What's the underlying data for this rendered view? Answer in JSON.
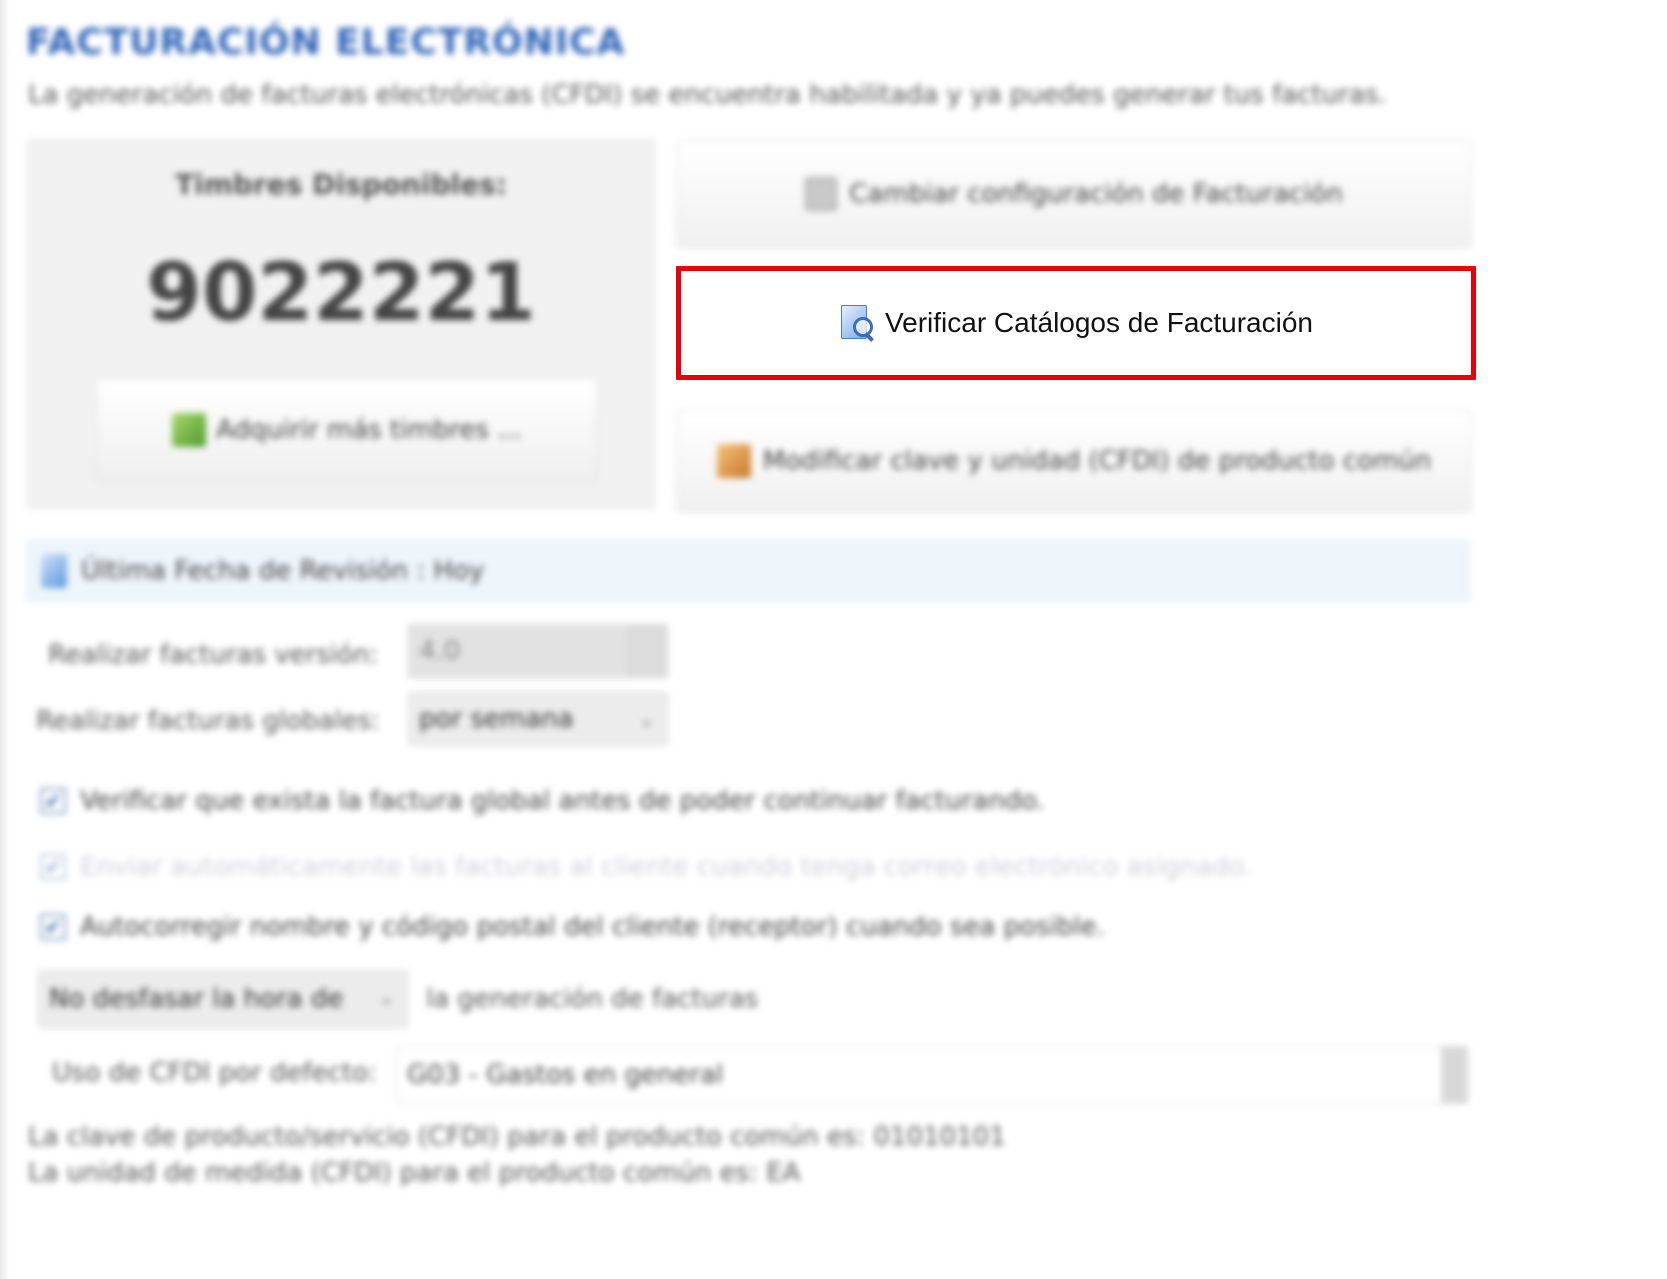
{
  "header": {
    "title": "FACTURACIÓN ELECTRÓNICA",
    "subtitle": "La generación de facturas electrónicas (CFDI) se encuentra habilitada y ya puedes generar tus facturas."
  },
  "stamps": {
    "label": "Timbres Disponibles:",
    "count": "9022221",
    "buy_label": "Adquirir más timbres ..."
  },
  "actions": {
    "change_config_label": "Cambiar configuración de Facturación",
    "verify_catalogs_label": "Verificar Catálogos de Facturación",
    "modify_key_label": "Modificar clave y unidad (CFDI) de producto común"
  },
  "review": {
    "text": "Última Fecha de Revisión : Hoy"
  },
  "settings": {
    "version_label": "Realizar facturas versión:",
    "version_value": "4.0",
    "global_label": "Realizar facturas globales:",
    "global_value": "por semana",
    "check_global_label": "Verificar que exista la factura global antes de poder continuar facturando.",
    "check_global_checked": true,
    "send_email_label": "Enviar automáticamente las facturas al cliente cuando tenga correo electrónico asignado.",
    "send_email_checked": true,
    "autocorrect_label": "Autocorregir nombre y código postal del cliente (receptor) cuando sea posible.",
    "autocorrect_checked": true,
    "time_select_value": "No desfasar la hora de",
    "time_suffix": "la generación de facturas",
    "cfdi_use_label": "Uso de CFDI por defecto:",
    "cfdi_use_value": "G03 - Gastos en general"
  },
  "info": {
    "product_key_line": "La clave de producto/servicio (CFDI) para el producto común es: 01010101",
    "unit_line": "La unidad de medida (CFDI) para el producto común es: EA"
  },
  "icons": {
    "buy": "shopping-cart-icon",
    "config": "config-icon",
    "verify": "catalog-search-icon",
    "modify": "product-edit-icon",
    "review": "calendar-icon"
  },
  "colors": {
    "title_blue": "#2f63b8",
    "highlight_red": "#e8000b"
  }
}
